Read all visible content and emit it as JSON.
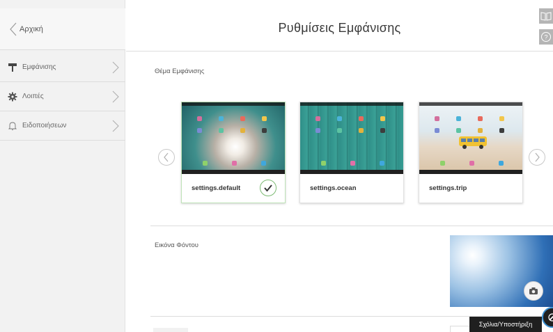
{
  "sidebar": {
    "back_label": "Αρχική",
    "items": [
      {
        "label": "Εμφάνισης",
        "icon": "paint-roller-icon"
      },
      {
        "label": "Λοιπές",
        "icon": "gear-icon"
      },
      {
        "label": "Ειδοποιήσεων",
        "icon": "bell-icon"
      }
    ]
  },
  "header": {
    "title": "Ρυθμίσεις Εμφάνισης",
    "tools": [
      "book-icon",
      "help-icon"
    ]
  },
  "theme_section": {
    "label": "Θέμα Εμφάνισης",
    "themes": [
      {
        "name": "settings.default",
        "selected": true
      },
      {
        "name": "settings.ocean",
        "selected": false
      },
      {
        "name": "settings.trip",
        "selected": false
      }
    ]
  },
  "wallpaper_section": {
    "label": "Εικόνα Φόντου"
  },
  "feedback": {
    "label": "Σχόλια/Υποστήριξη"
  },
  "colors": {
    "sidebar_bg": "#f2f2f2",
    "selected_border": "#7dbb74",
    "feedback_bg": "#1f1f1f",
    "feedback_ring": "#3a8fd1"
  }
}
